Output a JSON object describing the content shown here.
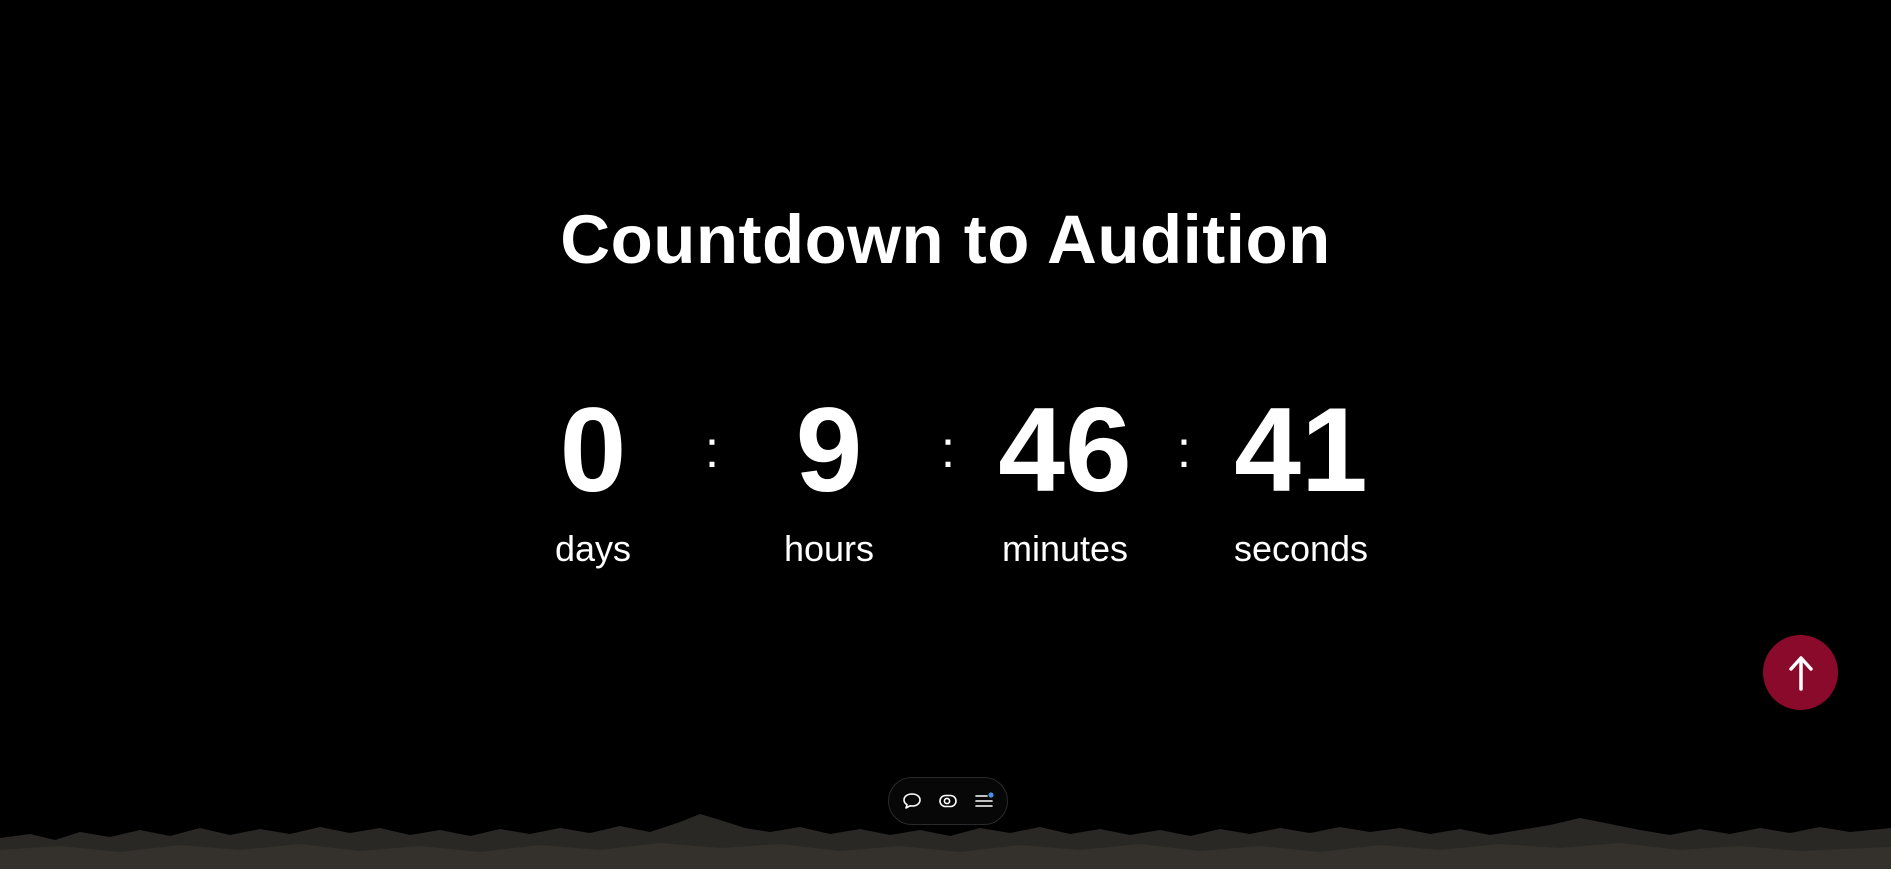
{
  "page": {
    "title": "Countdown to Audition",
    "background": "#000000"
  },
  "countdown": {
    "separator": ":",
    "units": [
      {
        "value": "0",
        "label": "days"
      },
      {
        "value": "9",
        "label": "hours"
      },
      {
        "value": "46",
        "label": "minutes"
      },
      {
        "value": "41",
        "label": "seconds"
      }
    ]
  },
  "scroll_top_button": {
    "icon": "arrow-up-icon",
    "color": "#8a0a2b"
  },
  "toolbar": {
    "items": [
      {
        "icon": "chat-bubble-icon"
      },
      {
        "icon": "eye-icon"
      },
      {
        "icon": "menu-list-icon",
        "badge_color": "#4a8fe7"
      }
    ]
  }
}
